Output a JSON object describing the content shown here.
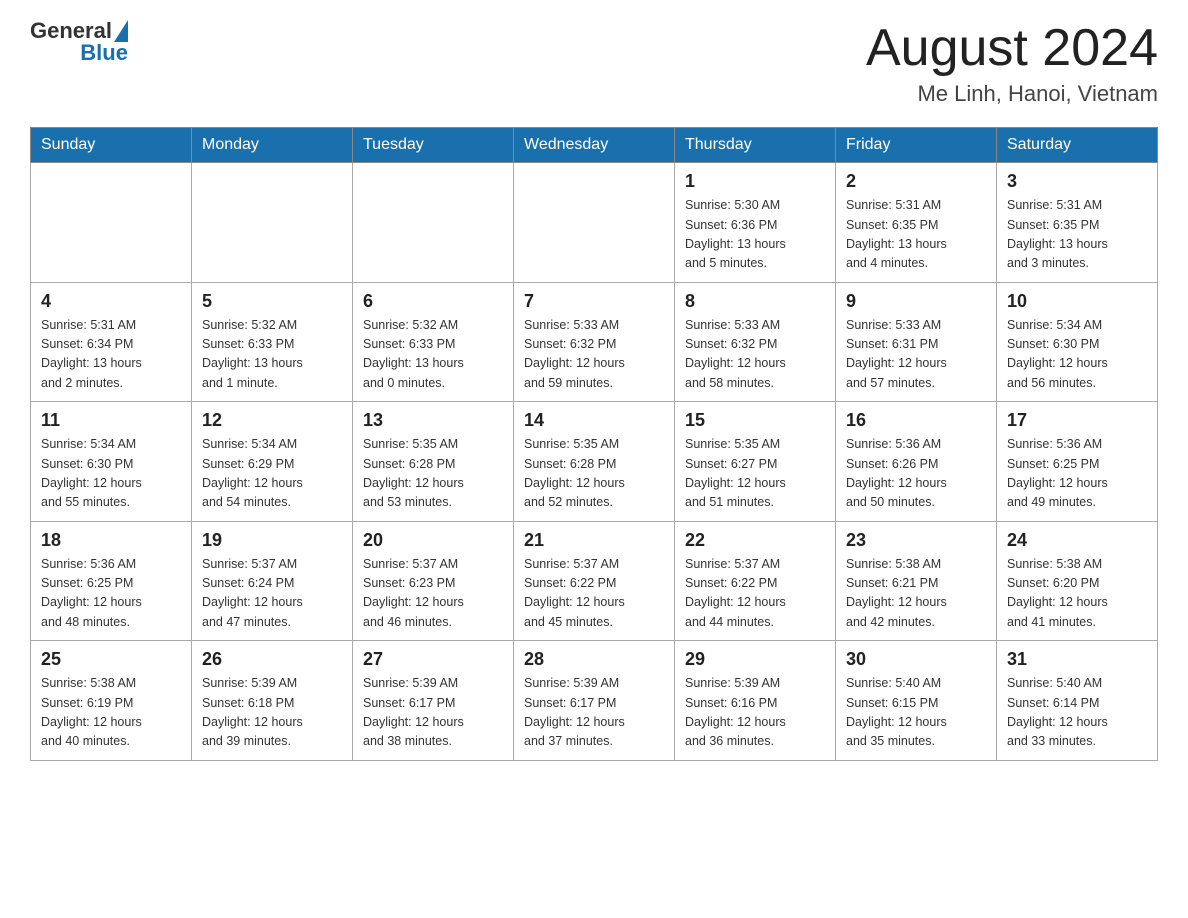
{
  "header": {
    "logo": {
      "text_general": "General",
      "text_blue": "Blue"
    },
    "title": "August 2024",
    "location": "Me Linh, Hanoi, Vietnam"
  },
  "weekdays": [
    "Sunday",
    "Monday",
    "Tuesday",
    "Wednesday",
    "Thursday",
    "Friday",
    "Saturday"
  ],
  "weeks": [
    [
      {
        "day": "",
        "info": ""
      },
      {
        "day": "",
        "info": ""
      },
      {
        "day": "",
        "info": ""
      },
      {
        "day": "",
        "info": ""
      },
      {
        "day": "1",
        "info": "Sunrise: 5:30 AM\nSunset: 6:36 PM\nDaylight: 13 hours\nand 5 minutes."
      },
      {
        "day": "2",
        "info": "Sunrise: 5:31 AM\nSunset: 6:35 PM\nDaylight: 13 hours\nand 4 minutes."
      },
      {
        "day": "3",
        "info": "Sunrise: 5:31 AM\nSunset: 6:35 PM\nDaylight: 13 hours\nand 3 minutes."
      }
    ],
    [
      {
        "day": "4",
        "info": "Sunrise: 5:31 AM\nSunset: 6:34 PM\nDaylight: 13 hours\nand 2 minutes."
      },
      {
        "day": "5",
        "info": "Sunrise: 5:32 AM\nSunset: 6:33 PM\nDaylight: 13 hours\nand 1 minute."
      },
      {
        "day": "6",
        "info": "Sunrise: 5:32 AM\nSunset: 6:33 PM\nDaylight: 13 hours\nand 0 minutes."
      },
      {
        "day": "7",
        "info": "Sunrise: 5:33 AM\nSunset: 6:32 PM\nDaylight: 12 hours\nand 59 minutes."
      },
      {
        "day": "8",
        "info": "Sunrise: 5:33 AM\nSunset: 6:32 PM\nDaylight: 12 hours\nand 58 minutes."
      },
      {
        "day": "9",
        "info": "Sunrise: 5:33 AM\nSunset: 6:31 PM\nDaylight: 12 hours\nand 57 minutes."
      },
      {
        "day": "10",
        "info": "Sunrise: 5:34 AM\nSunset: 6:30 PM\nDaylight: 12 hours\nand 56 minutes."
      }
    ],
    [
      {
        "day": "11",
        "info": "Sunrise: 5:34 AM\nSunset: 6:30 PM\nDaylight: 12 hours\nand 55 minutes."
      },
      {
        "day": "12",
        "info": "Sunrise: 5:34 AM\nSunset: 6:29 PM\nDaylight: 12 hours\nand 54 minutes."
      },
      {
        "day": "13",
        "info": "Sunrise: 5:35 AM\nSunset: 6:28 PM\nDaylight: 12 hours\nand 53 minutes."
      },
      {
        "day": "14",
        "info": "Sunrise: 5:35 AM\nSunset: 6:28 PM\nDaylight: 12 hours\nand 52 minutes."
      },
      {
        "day": "15",
        "info": "Sunrise: 5:35 AM\nSunset: 6:27 PM\nDaylight: 12 hours\nand 51 minutes."
      },
      {
        "day": "16",
        "info": "Sunrise: 5:36 AM\nSunset: 6:26 PM\nDaylight: 12 hours\nand 50 minutes."
      },
      {
        "day": "17",
        "info": "Sunrise: 5:36 AM\nSunset: 6:25 PM\nDaylight: 12 hours\nand 49 minutes."
      }
    ],
    [
      {
        "day": "18",
        "info": "Sunrise: 5:36 AM\nSunset: 6:25 PM\nDaylight: 12 hours\nand 48 minutes."
      },
      {
        "day": "19",
        "info": "Sunrise: 5:37 AM\nSunset: 6:24 PM\nDaylight: 12 hours\nand 47 minutes."
      },
      {
        "day": "20",
        "info": "Sunrise: 5:37 AM\nSunset: 6:23 PM\nDaylight: 12 hours\nand 46 minutes."
      },
      {
        "day": "21",
        "info": "Sunrise: 5:37 AM\nSunset: 6:22 PM\nDaylight: 12 hours\nand 45 minutes."
      },
      {
        "day": "22",
        "info": "Sunrise: 5:37 AM\nSunset: 6:22 PM\nDaylight: 12 hours\nand 44 minutes."
      },
      {
        "day": "23",
        "info": "Sunrise: 5:38 AM\nSunset: 6:21 PM\nDaylight: 12 hours\nand 42 minutes."
      },
      {
        "day": "24",
        "info": "Sunrise: 5:38 AM\nSunset: 6:20 PM\nDaylight: 12 hours\nand 41 minutes."
      }
    ],
    [
      {
        "day": "25",
        "info": "Sunrise: 5:38 AM\nSunset: 6:19 PM\nDaylight: 12 hours\nand 40 minutes."
      },
      {
        "day": "26",
        "info": "Sunrise: 5:39 AM\nSunset: 6:18 PM\nDaylight: 12 hours\nand 39 minutes."
      },
      {
        "day": "27",
        "info": "Sunrise: 5:39 AM\nSunset: 6:17 PM\nDaylight: 12 hours\nand 38 minutes."
      },
      {
        "day": "28",
        "info": "Sunrise: 5:39 AM\nSunset: 6:17 PM\nDaylight: 12 hours\nand 37 minutes."
      },
      {
        "day": "29",
        "info": "Sunrise: 5:39 AM\nSunset: 6:16 PM\nDaylight: 12 hours\nand 36 minutes."
      },
      {
        "day": "30",
        "info": "Sunrise: 5:40 AM\nSunset: 6:15 PM\nDaylight: 12 hours\nand 35 minutes."
      },
      {
        "day": "31",
        "info": "Sunrise: 5:40 AM\nSunset: 6:14 PM\nDaylight: 12 hours\nand 33 minutes."
      }
    ]
  ]
}
